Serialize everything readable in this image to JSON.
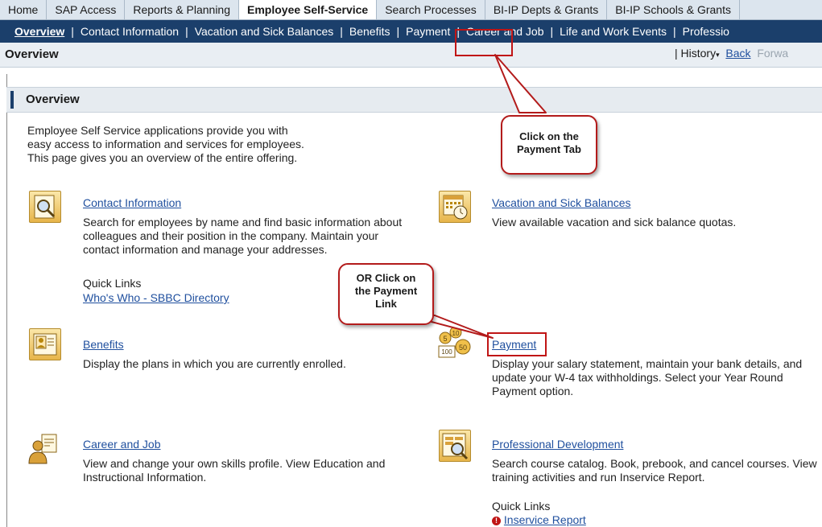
{
  "top_tabs": [
    "Home",
    "SAP Access",
    "Reports & Planning",
    "Employee Self-Service",
    "Search Processes",
    "BI-IP Depts & Grants",
    "BI-IP Schools & Grants"
  ],
  "sub_nav": [
    "Overview",
    "Contact Information",
    "Vacation and Sick Balances",
    "Benefits",
    "Payment",
    "Career and Job",
    "Life and Work Events",
    "Professio"
  ],
  "page_header": {
    "title": "Overview",
    "history": "History",
    "back": "Back",
    "forward": "Forwa"
  },
  "section_title": "Overview",
  "intro": [
    "Employee Self Service applications provide you with",
    "easy access to information and services for employees.",
    "This page gives you an overview of the entire offering."
  ],
  "services": {
    "contact": {
      "title": "Contact Information",
      "description": "Search for employees by name and find basic information about colleagues and their position in the company.  Maintain your contact information and manage your addresses.",
      "quick_links_label": "Quick Links",
      "quick_link": "Who's Who - SBBC Directory"
    },
    "vacation": {
      "title": "Vacation and Sick Balances",
      "description": "View available vacation and sick balance quotas."
    },
    "benefits": {
      "title": "Benefits",
      "description": "Display the plans in which you are currently enrolled."
    },
    "payment": {
      "title": "Payment",
      "description": "Display your salary statement, maintain your bank details, and update your W-4 tax withholdings.   Select your Year Round Payment option."
    },
    "career": {
      "title": "Career and Job",
      "description": "View and change your own skills profile.  View Education and Instructional Information."
    },
    "professional": {
      "title": "Professional Development",
      "description": "Search course catalog. Book, prebook, and cancel courses. View training activities and run Inservice Report.",
      "quick_links_label": "Quick Links",
      "quick_link": "Inservice Report"
    }
  },
  "callouts": {
    "tab": [
      "Click on the",
      "Payment Tab"
    ],
    "link": [
      "OR Click on",
      "the Payment",
      "Link"
    ]
  },
  "colors": {
    "nav_bar": "#1b3f6b",
    "link": "#1f4f9e",
    "highlight": "#c01515"
  },
  "icons": {
    "contact": "magnifier-card-icon",
    "vacation": "calendar-clock-icon",
    "benefits": "person-card-icon",
    "payment": "coins-icon",
    "career": "person-id-icon",
    "professional": "chart-magnifier-icon",
    "inservice": "alert-icon"
  }
}
